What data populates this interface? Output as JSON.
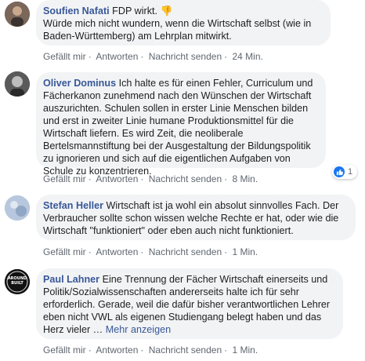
{
  "comments": [
    {
      "author": "Soufien Nafati",
      "text_line1": "FDP wirkt. 👎",
      "text_rest": "Würde mich nicht wundern, wenn die Wirtschaft selbst (wie in Baden-Württemberg) am Lehrplan mitwirkt.",
      "actions": {
        "like": "Gefällt mir",
        "reply": "Antworten",
        "message": "Nachricht senden",
        "time": "24 Min."
      }
    },
    {
      "author": "Oliver Dominus",
      "text": "Ich halte es für einen Fehler, Curriculum und Fächerkanon zunehmend nach den Wünschen der Wirtschaft auszurichten. Schulen sollen in erster Linie Menschen bilden und erst in zweiter Linie humane Produktionsmittel für die Wirtschaft liefern. Es wird Zeit, die neoliberale Bertelsmannstiftung bei der Ausgestaltung der Bildungspolitik zu ignorieren und sich auf die eigentlichen Aufgaben von Schule zu konzentrieren.",
      "reactions": {
        "count": "1"
      },
      "actions": {
        "like": "Gefällt mir",
        "reply": "Antworten",
        "message": "Nachricht senden",
        "time": "8 Min."
      }
    },
    {
      "author": "Stefan Heller",
      "text": "Wirtschaft ist ja wohl ein absolut sinnvolles Fach. Der Verbraucher sollte schon wissen welche Rechte er hat, oder wie die Wirtschaft \"funktioniert\" oder eben auch nicht funktioniert.",
      "actions": {
        "like": "Gefällt mir",
        "reply": "Antworten",
        "message": "Nachricht senden",
        "time": "1 Min."
      }
    },
    {
      "author": "Paul Lahner",
      "avatar_text": "AROUND BUILT",
      "text": "Eine Trennung der Fächer Wirtschaft einerseits und Politik/Sozialwissenschaften andererseits halte ich für sehr erforderlich. Gerade, weil die dafür bisher verantwortlichen Lehrer eben nicht VWL als eigenen Studiengang belegt haben und das Herz vieler …",
      "more_label": "Mehr anzeigen",
      "actions": {
        "like": "Gefällt mir",
        "reply": "Antworten",
        "message": "Nachricht senden",
        "time": "1 Min."
      }
    }
  ],
  "colors": {
    "author": "#385898",
    "bubble": "#f2f3f5",
    "meta": "#606770",
    "like_blue": "#1877f2"
  }
}
